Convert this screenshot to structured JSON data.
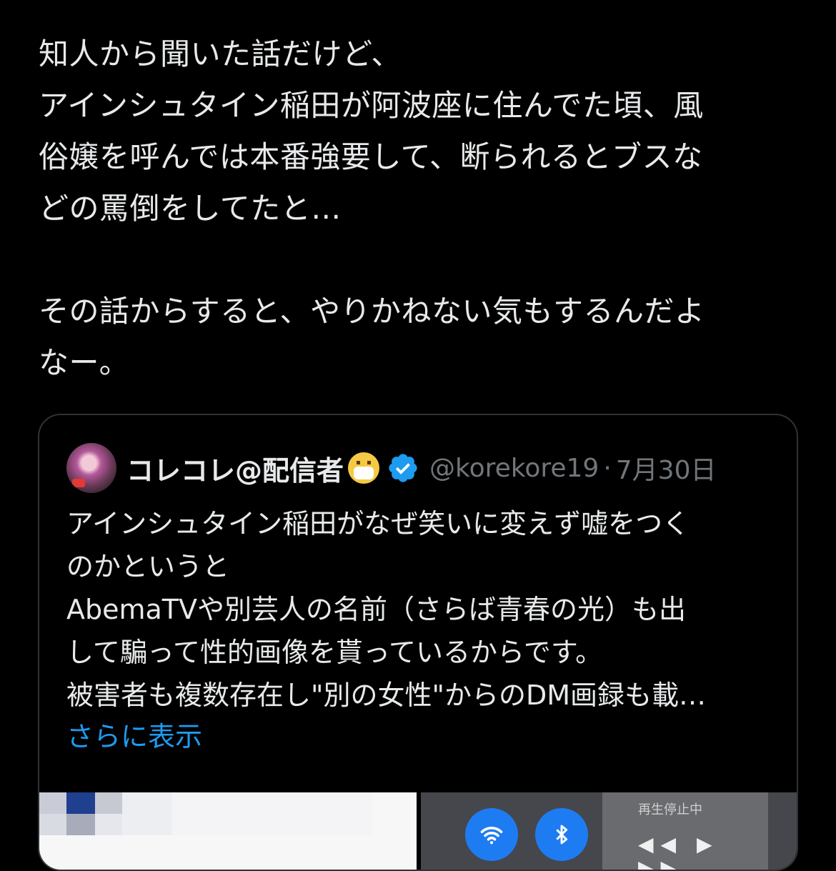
{
  "post": {
    "lines": [
      "知人から聞いた話だけど、",
      "アインシュタイン稲田が阿波座に住んでた頃、風",
      "俗嬢を呼んでは本番強要して、断られるとブスな",
      "どの罵倒をしてたと…",
      "",
      "その話からすると、やりかねない気もするんだよ",
      "なー。"
    ]
  },
  "quote": {
    "display_name": "コレコレ@配信者",
    "handle": "@korekore19",
    "separator": "·",
    "timestamp": "7月30日",
    "body_lines": [
      "アインシュタイン稲田がなぜ笑いに変えず嘘をつく",
      "のかというと",
      "AbemaTVや別芸人の名前（さらば青春の光）も出",
      "して騙って性的画像を貰っているからです。",
      "被害者も複数存在し\"別の女性\"からのDM画録も載…"
    ],
    "show_more": "さらに表示",
    "media_right_label": "再生停止中"
  },
  "colors": {
    "background": "#000000",
    "text": "#e7e9ea",
    "secondary": "#71767b",
    "link": "#1d9bf0",
    "verified": "#1d9bf0",
    "border": "#2f3336"
  }
}
